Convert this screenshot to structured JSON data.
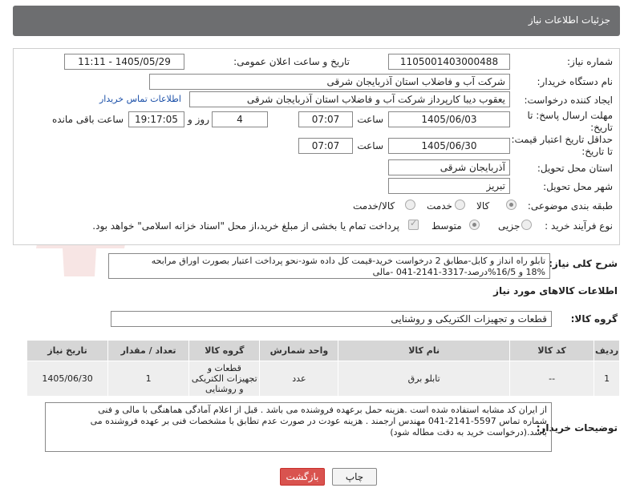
{
  "header": {
    "title": "جزئیات اطلاعات نیاز"
  },
  "fields": {
    "need_number_label": "شماره نیاز:",
    "need_number": "1105001403000488",
    "announce_label": "تاریخ و ساعت اعلان عمومی:",
    "announce_value": "1405/05/29 - 11:11",
    "buyer_org_label": "نام دستگاه خریدار:",
    "buyer_org": "شرکت آب و فاضلاب استان آذربایجان شرقی",
    "requester_label": "ایجاد کننده درخواست:",
    "requester": "یعقوب دیبا کارپرداز شرکت آب و فاضلاب استان آذربایجان شرقی",
    "contact_link": "اطلاعات تماس خریدار",
    "deadline_label": "مهلت ارسال پاسخ: تا تاریخ:",
    "deadline_date": "1405/06/03",
    "time_label": "ساعت",
    "deadline_time": "07:07",
    "days_value": "4",
    "days_label": "روز و",
    "remaining_time": "19:17:05",
    "remaining_label": "ساعت باقی مانده",
    "validity_label": "حداقل تاریخ اعتبار قیمت: تا تاریخ:",
    "validity_date": "1405/06/30",
    "validity_time": "07:07",
    "province_label": "استان محل تحویل:",
    "province": "آذربایجان شرقی",
    "city_label": "شهر محل تحویل:",
    "city": "تبریز",
    "category_label": "طبقه بندی موضوعی:",
    "category_options": [
      "کالا",
      "خدمت",
      "کالا/خدمت"
    ],
    "process_label": "نوع فرآیند خرید :",
    "process_options": [
      "جزیی",
      "متوسط"
    ],
    "payment_note": "پرداخت تمام یا بخشی از مبلغ خرید،از محل \"اسناد خزانه اسلامی\" خواهد بود."
  },
  "description": {
    "label": "شرح کلی نیاز:",
    "line1": "تابلو راه انداز و کابل-مطابق 2 درخواست خرید-قیمت کل داده شود-نحو پرداخت اعتبار بصورت اوراق مرابحه",
    "line2": "18% و 16/5%درصد-3317-2141-041 -مالی"
  },
  "goods": {
    "section_title": "اطلاعات کالاهای مورد نیاز",
    "group_label": "گروه کالا:",
    "group_value": "قطعات و تجهیزات الکتریکی و روشنایی",
    "columns": [
      "ردیف",
      "کد کالا",
      "نام کالا",
      "واحد شمارش",
      "گروه کالا",
      "تعداد / مقدار",
      "تاریخ نیاز"
    ],
    "rows": [
      {
        "row": "1",
        "code": "--",
        "name": "تابلو برق",
        "unit": "عدد",
        "group": "قطعات و تجهیزات الکتریکی و روشنایی",
        "qty": "1",
        "date": "1405/06/30"
      }
    ]
  },
  "buyer_notes": {
    "label": "توضیحات خریدار:",
    "line1": "از ایران کد مشابه استفاده شده است .هزینه حمل برعهده فروشنده می باشد . قبل از اعلام آمادگی هماهنگی با مالی و فنی",
    "line2": "شماره تماس 5597-2141-041 مهندس ارجمند . هزینه عودت در صورت عدم تطابق با مشخصات فنی بر عهده فروشنده می",
    "line3": "باشد.(درخواست خرید به دقت مطاله شود)"
  },
  "buttons": {
    "print": "چاپ",
    "back": "بازگشت"
  },
  "watermark_text": "AriaTender.net",
  "colors": {
    "header": "#6d6e70",
    "back_button": "#d9534f",
    "link": "#1a4fa8"
  }
}
